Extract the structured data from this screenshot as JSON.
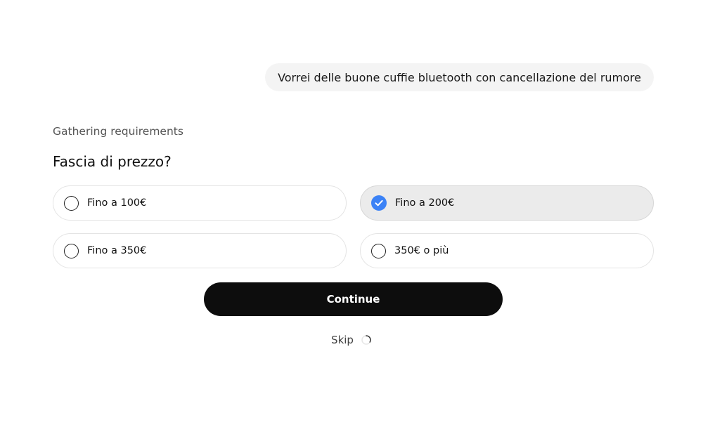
{
  "chat": {
    "user_message": "Vorrei delle buone cuffie bluetooth con cancellazione del rumore"
  },
  "assistant": {
    "status": "Gathering requirements",
    "question": "Fascia di prezzo?"
  },
  "options": [
    {
      "label": "Fino a 100€",
      "selected": false
    },
    {
      "label": "Fino a 200€",
      "selected": true
    },
    {
      "label": "Fino a 350€",
      "selected": false
    },
    {
      "label": "350€ o più",
      "selected": false
    }
  ],
  "actions": {
    "continue_label": "Continue",
    "skip_label": "Skip"
  },
  "colors": {
    "accent": "#3b82f6",
    "button_bg": "#0d0d0d",
    "selected_bg": "#ebebeb",
    "bubble_bg": "#f4f4f4"
  },
  "icons": {
    "unchecked": "radio-unchecked-icon",
    "checked": "radio-checked-icon",
    "loading": "loading-spinner-icon"
  }
}
